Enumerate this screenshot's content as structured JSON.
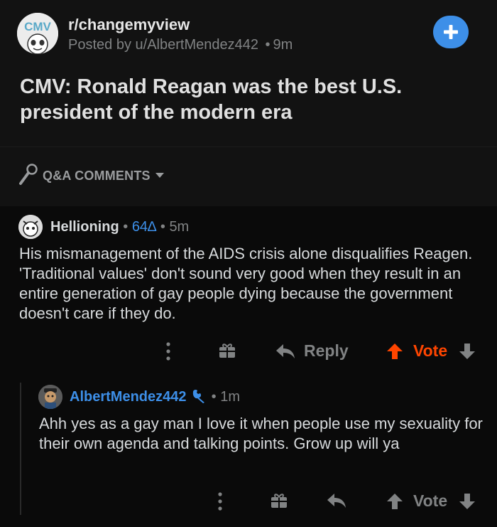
{
  "post": {
    "subreddit": "r/changemyview",
    "subreddit_icon_text": "CMV",
    "posted_by_prefix": "Posted by",
    "author": "u/AlbertMendez442",
    "separator": "•",
    "age": "9m",
    "title": "CMV: Ronald Reagan was the best U.S. president of the modern era"
  },
  "sort_bar": {
    "label": "Q&A COMMENTS"
  },
  "comments": [
    {
      "user": "Hellioning",
      "separator": "•",
      "delta": "64∆",
      "age": "5m",
      "body": "His mismanagement of the AIDS crisis alone disqualifies Reagen. 'Traditional values' don't sound very good when they result in an entire generation of gay people dying because the government doesn't care if they do.",
      "reply_label": "Reply",
      "vote_label": "Vote",
      "vote_state": "upvoted",
      "vote_color": "#ff4500"
    },
    {
      "user": "AlbertMendez442",
      "separator": "•",
      "age": "1m",
      "body": "Ahh yes as a gay man I love it when people use my sexuality for their own agenda and talking points. Grow up will ya",
      "vote_label": "Vote",
      "is_op": true,
      "op_color": "#3d8fe8"
    }
  ],
  "colors": {
    "accent_blue": "#3d8fe8",
    "upvote_orange": "#ff4500",
    "background": "#0d0d0d"
  },
  "icons": [
    "subreddit-avatar-icon",
    "plus-icon",
    "microphone-icon",
    "chevron-down-icon",
    "more-icon",
    "gift-icon",
    "reply-icon",
    "upvote-icon",
    "downvote-icon",
    "mod-wrench-icon",
    "user-avatar-icon"
  ]
}
